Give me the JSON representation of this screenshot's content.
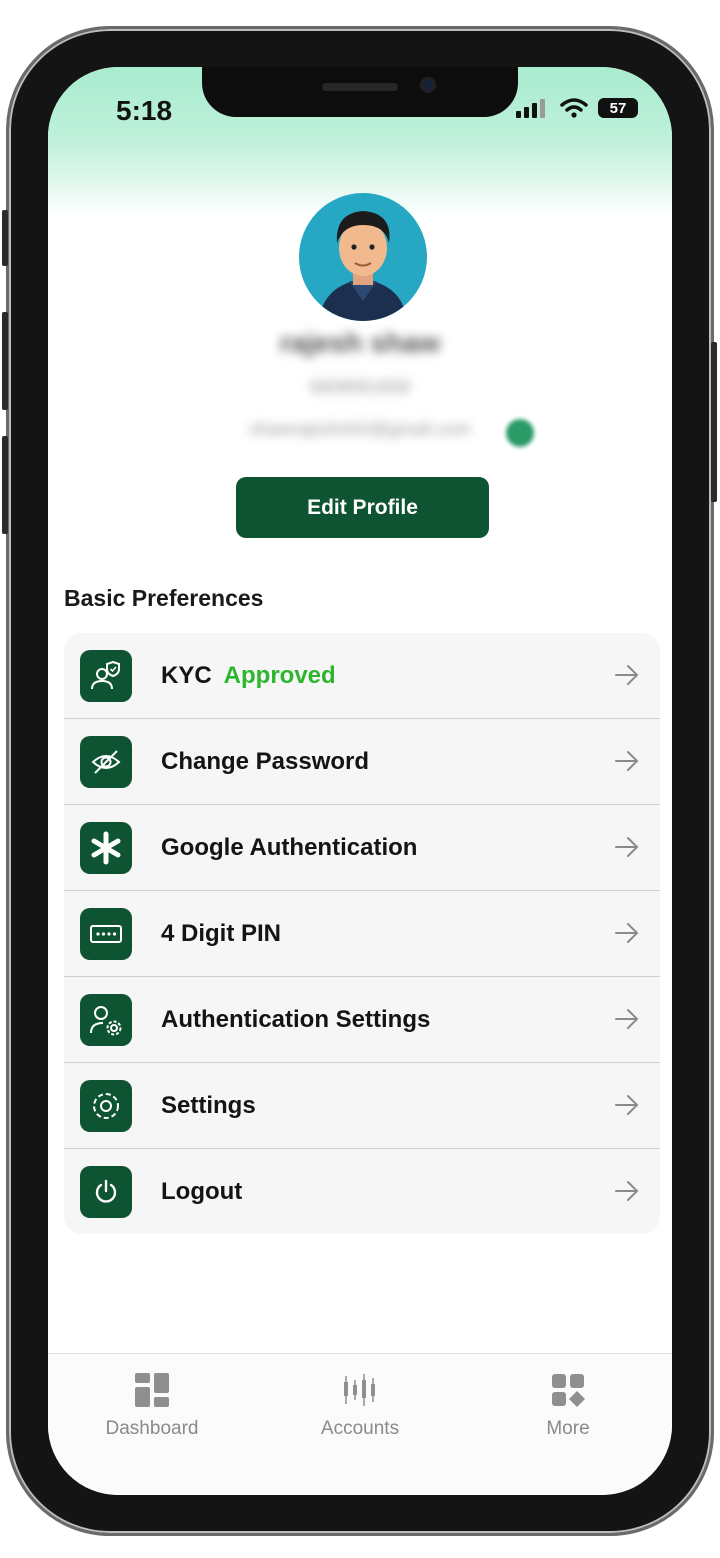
{
  "status_bar": {
    "time": "5:18",
    "battery": "57"
  },
  "profile": {
    "name": "rajesh shaw",
    "phone": "6808061608",
    "email": "shawrajesh442@gmail.com",
    "edit_button": "Edit Profile"
  },
  "preferences": {
    "title": "Basic Preferences",
    "items": [
      {
        "label": "KYC",
        "status": "Approved",
        "icon": "kyc-shield-user-icon"
      },
      {
        "label": "Change Password",
        "icon": "eye-off-icon"
      },
      {
        "label": "Google Authentication",
        "icon": "asterisk-icon"
      },
      {
        "label": "4 Digit PIN",
        "icon": "pin-input-icon"
      },
      {
        "label": "Authentication Settings",
        "icon": "user-settings-icon"
      },
      {
        "label": "Settings",
        "icon": "gear-icon"
      },
      {
        "label": "Logout",
        "icon": "power-icon"
      }
    ]
  },
  "bottom_nav": {
    "items": [
      {
        "label": "Dashboard",
        "icon": "dashboard-grid-icon"
      },
      {
        "label": "Accounts",
        "icon": "candlestick-icon"
      },
      {
        "label": "More",
        "icon": "apps-more-icon"
      }
    ]
  },
  "colors": {
    "primary": "#0f5432",
    "approved": "#2db52d",
    "header_gradient": "#a8ecd0"
  }
}
